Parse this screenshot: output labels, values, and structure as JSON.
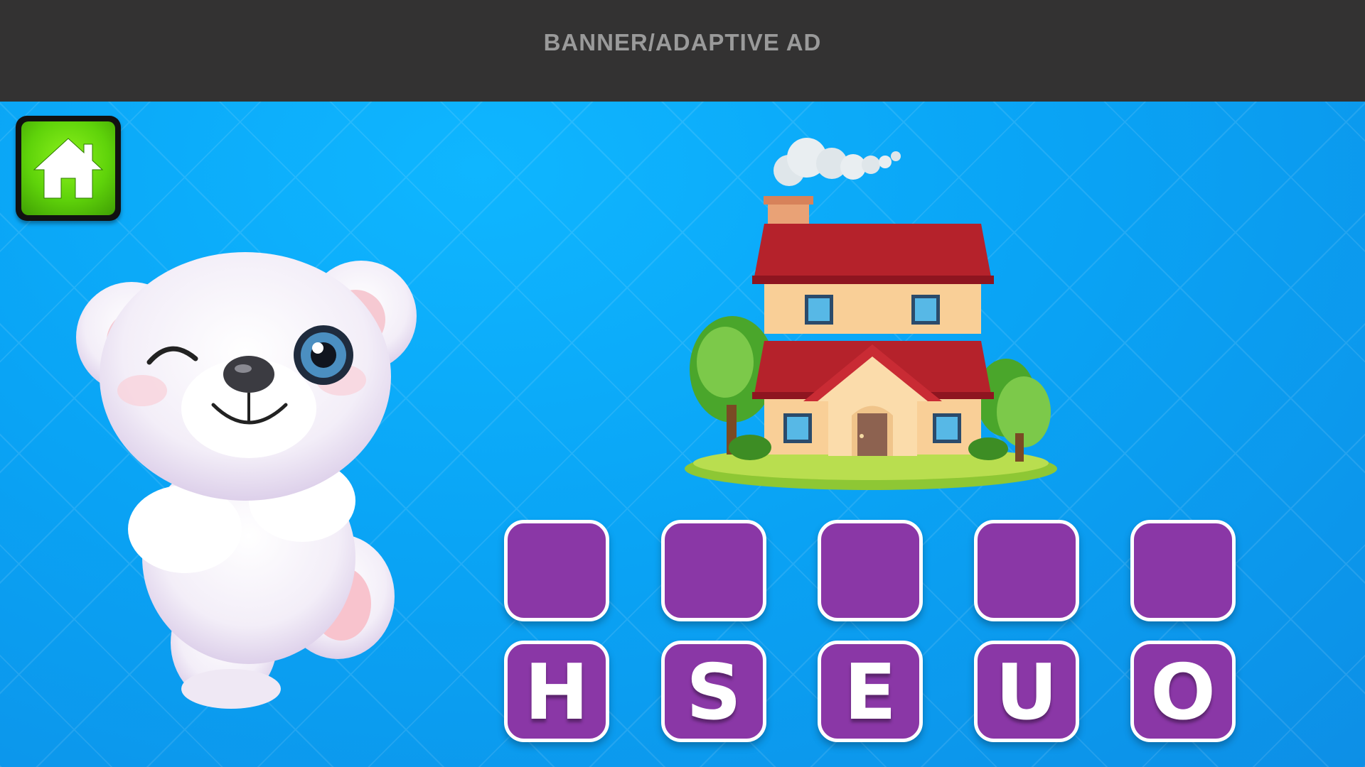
{
  "ad": {
    "label": "BANNER/ADAPTIVE AD"
  },
  "home_button": {
    "icon": "home-icon",
    "color": "#5fd30a"
  },
  "picture": {
    "icon": "house-icon"
  },
  "mascot": {
    "icon": "teddy-bear-icon"
  },
  "answer_slots": [
    "",
    "",
    "",
    "",
    ""
  ],
  "letter_tiles": [
    "H",
    "S",
    "E",
    "U",
    "O"
  ],
  "colors": {
    "tile": "#8a37a6",
    "background": "#0aa4f5",
    "banner": "#333232"
  }
}
